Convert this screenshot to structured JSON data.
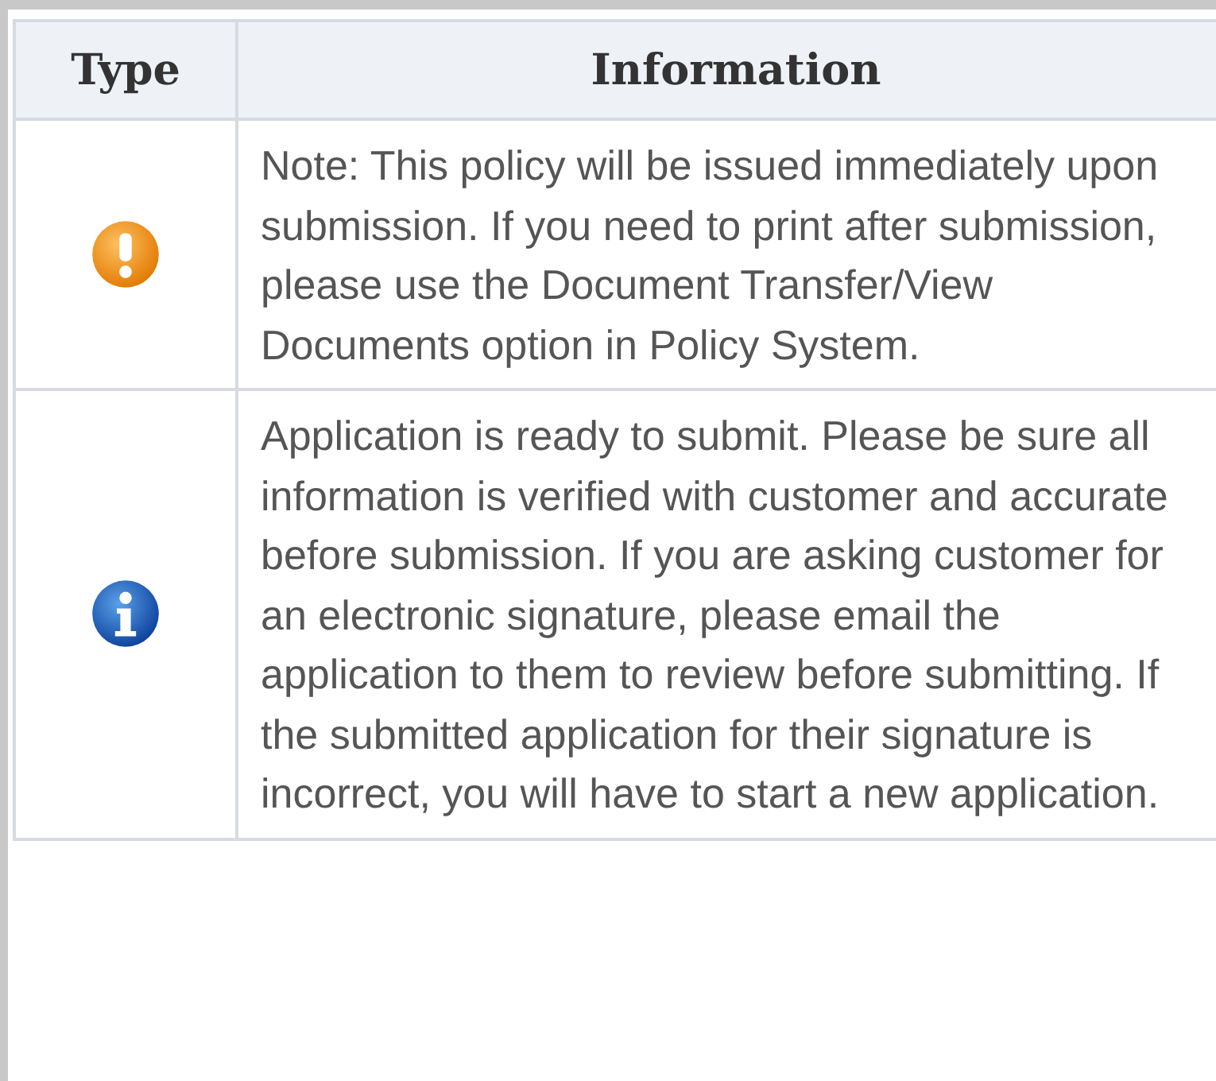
{
  "table": {
    "columns": [
      "Type",
      "Information"
    ],
    "rows": [
      {
        "kind": "warning",
        "text": "Note: This policy will be issued immediately upon submission. If you need to print after submission, please use the Document Transfer/View Documents option in Policy System."
      },
      {
        "kind": "info",
        "text": "Application is ready to submit. Please be sure all information is verified with customer and accurate before submission. If you are asking customer for an electronic signature, please email the application to them to review before submitting. If the submitted application for their signature is incorrect, you will have to start a new application."
      }
    ]
  }
}
